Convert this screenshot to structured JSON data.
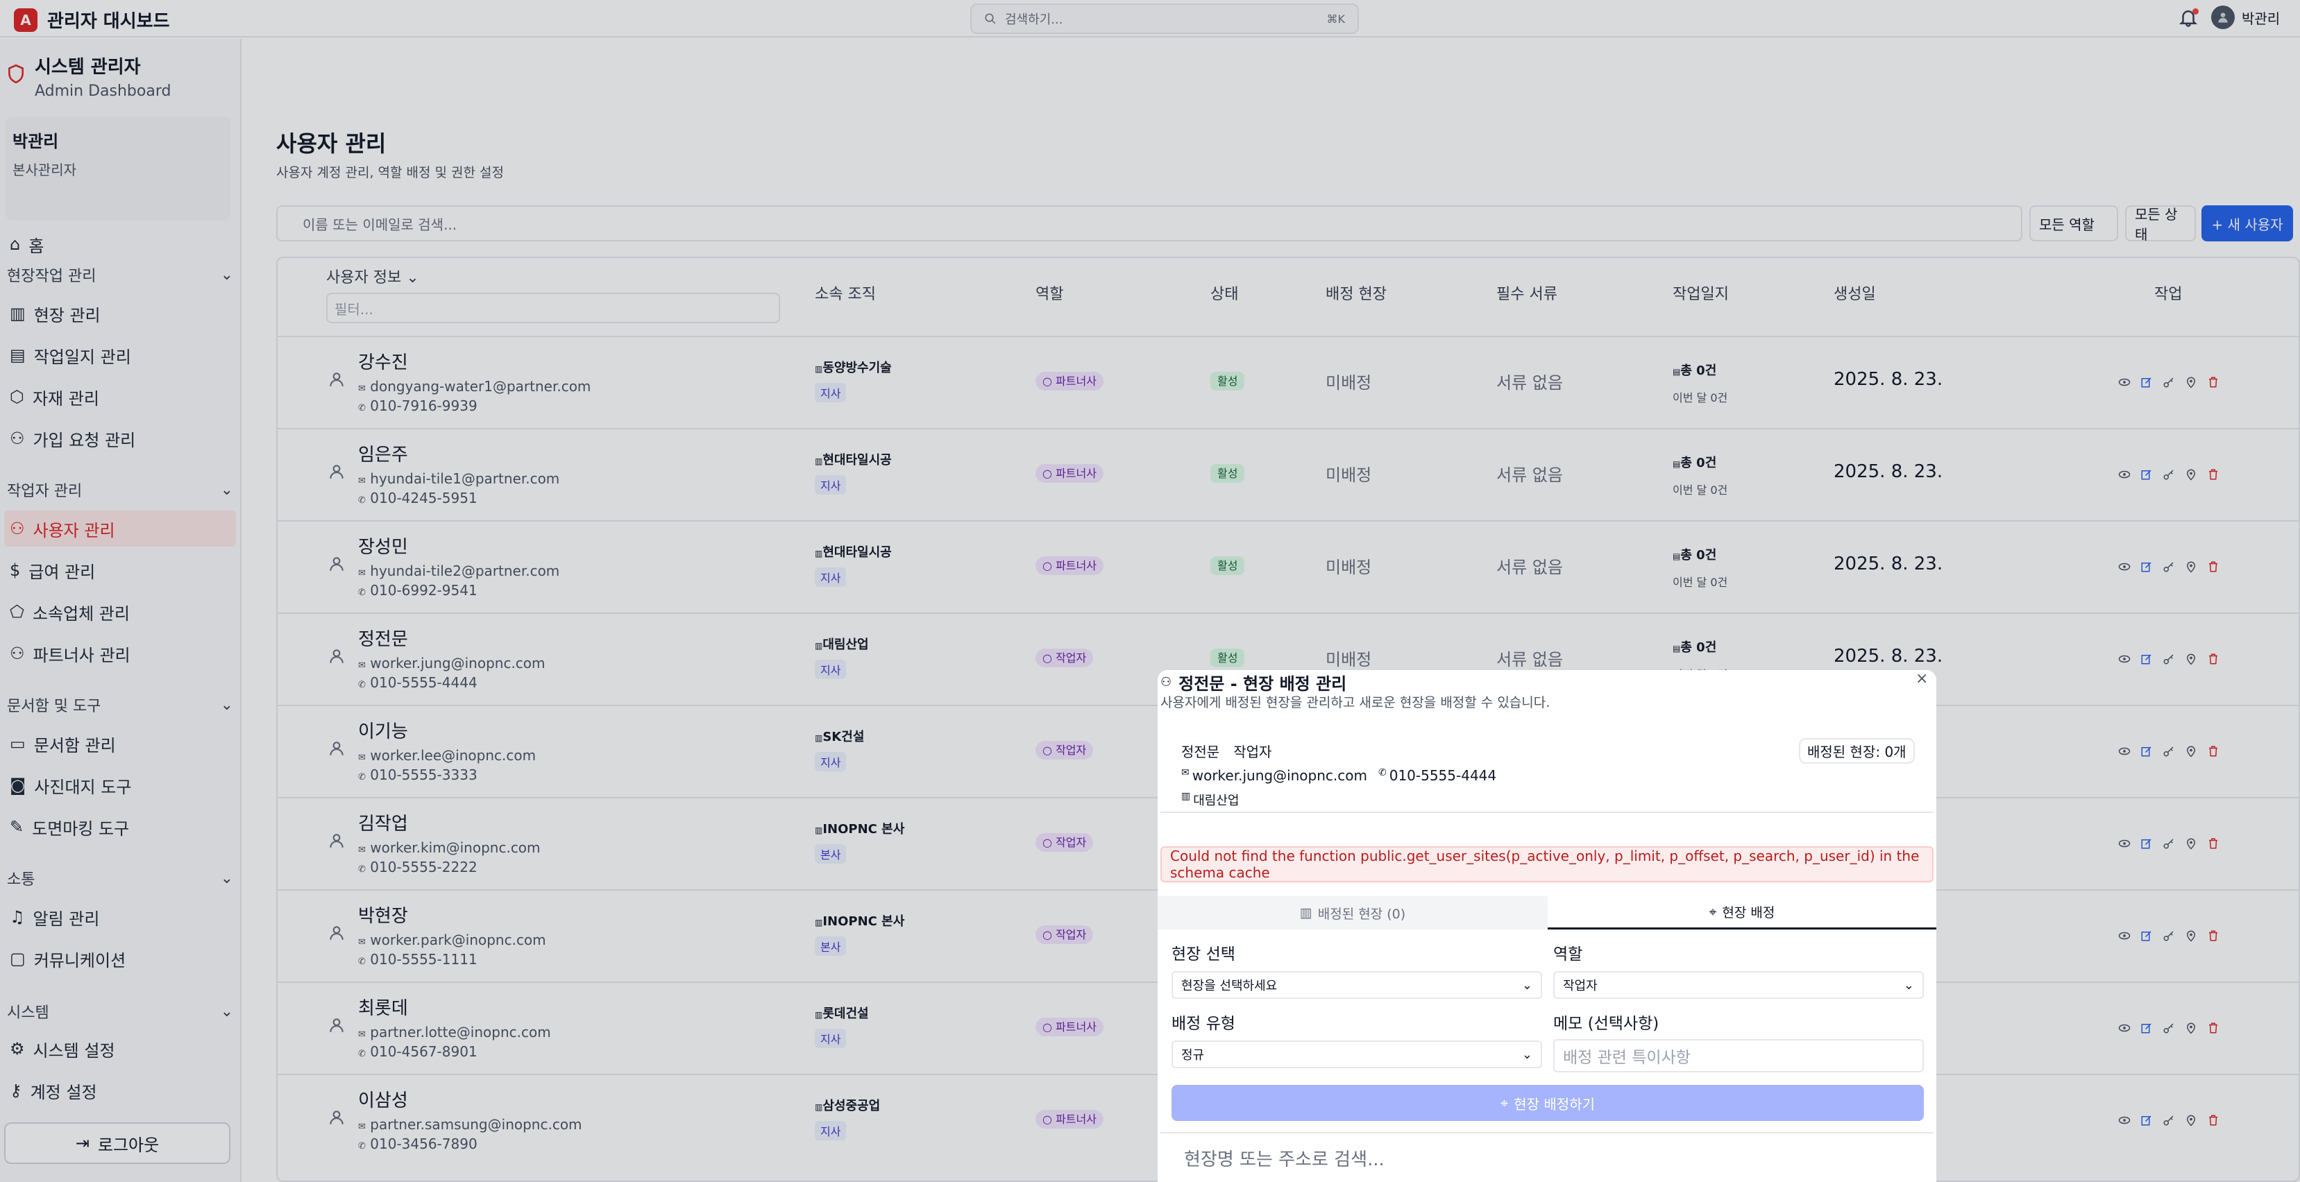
{
  "topbar": {
    "logo_letter": "A",
    "title": "관리자 대시보드",
    "search_placeholder": "검색하기...",
    "search_shortcut": "⌘K",
    "user_name": "박관리"
  },
  "sidebar": {
    "system_title": "시스템 관리자",
    "system_subtitle": "Admin Dashboard",
    "profile_name": "박관리",
    "profile_role": "본사관리자",
    "home": "홈",
    "groups": {
      "field_work": "현장작업 관리",
      "worker": "작업자 관리",
      "docs": "문서함 및 도구",
      "comm": "소통",
      "system": "시스템"
    },
    "items": {
      "site": "현장 관리",
      "worklog": "작업일지 관리",
      "material": "자재 관리",
      "signup": "가입 요청 관리",
      "users": "사용자 관리",
      "salary": "급여 관리",
      "company": "소속업체 관리",
      "partner": "파트너사 관리",
      "docbox": "문서함 관리",
      "photo": "사진대지 도구",
      "drawing": "도면마킹 도구",
      "alerts": "알림 관리",
      "community": "커뮤니케이션",
      "settings": "시스템 설정",
      "account": "계정 설정"
    },
    "logout": "로그아웃"
  },
  "main": {
    "title": "사용자 관리",
    "subtitle": "사용자 계정 관리, 역할 배정 및 권한 설정",
    "search_placeholder": "이름 또는 이메일로 검색...",
    "role_filter": "모든 역할",
    "status_filter": "모든 상태",
    "new_user": "+ 새 사용자",
    "columns": {
      "user": "사용자 정보",
      "org": "소속 조직",
      "role": "역할",
      "status": "상태",
      "site": "배정 현장",
      "docs": "필수 서류",
      "log": "작업일지",
      "created": "생성일",
      "actions": "작업"
    },
    "column_filter_placeholder": "필터...",
    "rows": [
      {
        "name": "강수진",
        "email": "dongyang-water1@partner.com",
        "phone": "010-7916-9939",
        "org": "동양방수기술",
        "org_type": "지사",
        "role": "파트너사",
        "status": "활성",
        "site": "미배정",
        "docs": "서류 없음",
        "log_total": "총 0건",
        "log_month": "이번 달 0건",
        "created": "2025. 8. 23."
      },
      {
        "name": "임은주",
        "email": "hyundai-tile1@partner.com",
        "phone": "010-4245-5951",
        "org": "현대타일시공",
        "org_type": "지사",
        "role": "파트너사",
        "status": "활성",
        "site": "미배정",
        "docs": "서류 없음",
        "log_total": "총 0건",
        "log_month": "이번 달 0건",
        "created": "2025. 8. 23."
      },
      {
        "name": "장성민",
        "email": "hyundai-tile2@partner.com",
        "phone": "010-6992-9541",
        "org": "현대타일시공",
        "org_type": "지사",
        "role": "파트너사",
        "status": "활성",
        "site": "미배정",
        "docs": "서류 없음",
        "log_total": "총 0건",
        "log_month": "이번 달 0건",
        "created": "2025. 8. 23."
      },
      {
        "name": "정전문",
        "email": "worker.jung@inopnc.com",
        "phone": "010-5555-4444",
        "org": "대림산업",
        "org_type": "지사",
        "role": "작업자",
        "status": "활성",
        "site": "미배정",
        "docs": "서류 없음",
        "log_total": "총 0건",
        "log_month": "이번 달 0건",
        "created": "2025. 8. 23."
      },
      {
        "name": "이기능",
        "email": "worker.lee@inopnc.com",
        "phone": "010-5555-3333",
        "org": "SK건설",
        "org_type": "지사",
        "role": "작업자",
        "status": "",
        "site": "",
        "docs": "",
        "log_total": "",
        "log_month": "",
        "created": ""
      },
      {
        "name": "김작업",
        "email": "worker.kim@inopnc.com",
        "phone": "010-5555-2222",
        "org": "INOPNC 본사",
        "org_type": "본사",
        "role": "작업자",
        "status": "",
        "site": "",
        "docs": "",
        "log_total": "",
        "log_month": "",
        "created": ""
      },
      {
        "name": "박현장",
        "email": "worker.park@inopnc.com",
        "phone": "010-5555-1111",
        "org": "INOPNC 본사",
        "org_type": "본사",
        "role": "작업자",
        "status": "",
        "site": "",
        "docs": "",
        "log_total": "",
        "log_month": "",
        "created": ""
      },
      {
        "name": "최롯데",
        "email": "partner.lotte@inopnc.com",
        "phone": "010-4567-8901",
        "org": "롯데건설",
        "org_type": "지사",
        "role": "파트너사",
        "status": "",
        "site": "",
        "docs": "",
        "log_total": "",
        "log_month": "",
        "created": ""
      },
      {
        "name": "이삼성",
        "email": "partner.samsung@inopnc.com",
        "phone": "010-3456-7890",
        "org": "삼성중공업",
        "org_type": "지사",
        "role": "파트너사",
        "status": "",
        "site": "",
        "docs": "",
        "log_total": "",
        "log_month": "",
        "created": ""
      }
    ]
  },
  "modal": {
    "title": "정전문 - 현장 배정 관리",
    "description": "사용자에게 배정된 현장을 관리하고 새로운 현장을 배정할 수 있습니다.",
    "close": "×",
    "user_name": "정전문",
    "user_role": "작업자",
    "assigned_count": "배정된 현장: 0개",
    "email": "worker.jung@inopnc.com",
    "phone": "010-5555-4444",
    "org": "대림산업",
    "error": "Could not find the function public.get_user_sites(p_active_only, p_limit, p_offset, p_search, p_user_id) in the schema cache",
    "tab_assigned": "배정된 현장 (0)",
    "tab_assign": "현장 배정",
    "site_label": "현장 선택",
    "site_placeholder": "현장을 선택하세요",
    "role_label": "역할",
    "role_value": "작업자",
    "type_label": "배정 유형",
    "type_value": "정규",
    "memo_label": "메모 (선택사항)",
    "memo_placeholder": "배정 관련 특이사항",
    "assign_button": "현장 배정하기",
    "search_placeholder": "현장명 또는 주소로 검색..."
  },
  "colors": {
    "accent": "#dc2626",
    "primary": "#2563eb",
    "error_text": "#b91c1c",
    "button_disabled": "#a5b4fc"
  }
}
